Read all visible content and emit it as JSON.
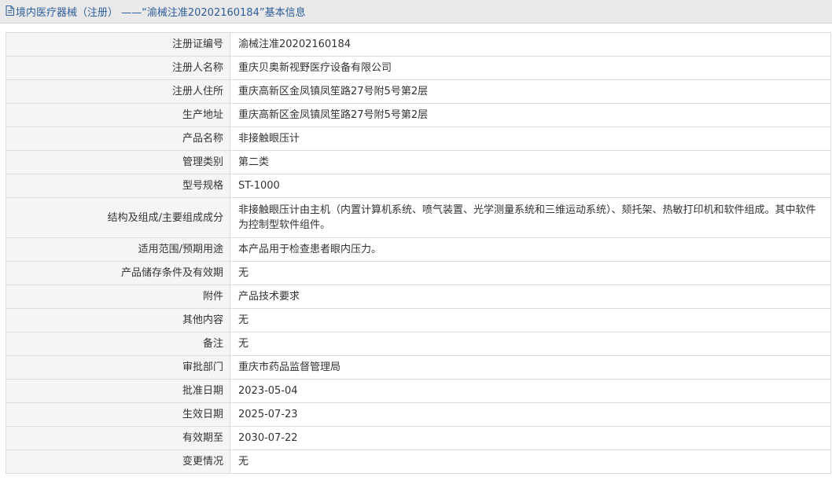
{
  "header": {
    "icon": "document-icon",
    "title": "境内医疗器械（注册） ——“渝械注准20202160184”基本信息"
  },
  "rows": [
    {
      "label": "注册证编号",
      "value": "渝械注准20202160184"
    },
    {
      "label": "注册人名称",
      "value": "重庆贝奥新视野医疗设备有限公司"
    },
    {
      "label": "注册人住所",
      "value": "重庆高新区金凤镇凤笙路27号附5号第2层"
    },
    {
      "label": "生产地址",
      "value": "重庆高新区金凤镇凤笙路27号附5号第2层"
    },
    {
      "label": "产品名称",
      "value": "非接触眼压计"
    },
    {
      "label": "管理类别",
      "value": "第二类"
    },
    {
      "label": "型号规格",
      "value": "ST-1000"
    },
    {
      "label": "结构及组成/主要组成成分",
      "value": "非接触眼压计由主机（内置计算机系统、喷气装置、光学测量系统和三维运动系统）、颏托架、热敏打印机和软件组成。其中软件为控制型软件组件。"
    },
    {
      "label": "适用范围/预期用途",
      "value": "本产品用于检查患者眼内压力。"
    },
    {
      "label": "产品储存条件及有效期",
      "value": "无"
    },
    {
      "label": "附件",
      "value": "产品技术要求"
    },
    {
      "label": "其他内容",
      "value": "无"
    },
    {
      "label": "备注",
      "value": "无"
    },
    {
      "label": "审批部门",
      "value": "重庆市药品监督管理局"
    },
    {
      "label": "批准日期",
      "value": "2023-05-04"
    },
    {
      "label": "生效日期",
      "value": "2025-07-23"
    },
    {
      "label": "有效期至",
      "value": "2030-07-22"
    },
    {
      "label": "变更情况",
      "value": "无"
    }
  ]
}
